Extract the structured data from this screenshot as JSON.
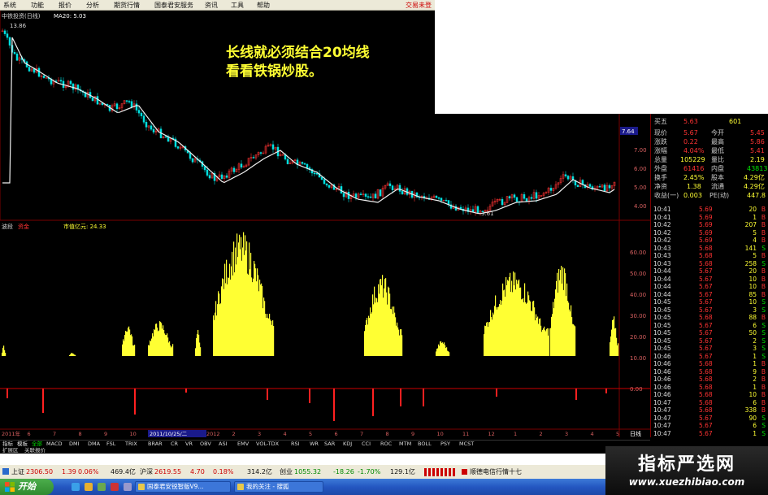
{
  "menu": {
    "items": [
      "系统",
      "功能",
      "报价",
      "分析",
      "期货行情",
      "国泰君安服务",
      "资讯",
      "工具",
      "帮助"
    ],
    "right_label": "交易未登"
  },
  "main_chart": {
    "stock_label": "中铁投资(日线)",
    "ma_label": "MA20: 5.03",
    "high_label": "13.86",
    "low_label": "3.61",
    "annotation_line1": "长线就必须结合20均线",
    "annotation_line2": "看看铁锅炒股。",
    "price_axis": [
      "7.64",
      "7.00",
      "6.00",
      "5.00",
      "4.00"
    ]
  },
  "sub_chart": {
    "name_label": "波段",
    "param_label": "资金",
    "flow_label": "市值亿元: 24.33",
    "axis": [
      "60.00",
      "50.00",
      "40.00",
      "30.00",
      "20.00",
      "10.00"
    ],
    "lower_axis": "0.00"
  },
  "date_axis": {
    "labels": [
      "2011年",
      "6",
      "7",
      "8",
      "9",
      "10",
      "11",
      "12",
      "2012",
      "2",
      "3",
      "4",
      "5",
      "6",
      "7",
      "8",
      "9",
      "10",
      "11",
      "12",
      "1",
      "2",
      "3",
      "4",
      "5"
    ],
    "cursor_date": "2011/10/25/二",
    "corner_label": "日线"
  },
  "quote_panel": {
    "rows": [
      {
        "label": "买五",
        "value": "5.63",
        "right": "601"
      },
      {
        "label": "现价",
        "value": "5.67",
        "label2": "今开",
        "value2": "5.45"
      },
      {
        "label": "涨跌",
        "value": "0.22",
        "label2": "最高",
        "value2": "5.86"
      },
      {
        "label": "涨幅",
        "value": "4.04%",
        "label2": "最低",
        "value2": "5.41"
      },
      {
        "label": "总量",
        "value": "105229",
        "label2": "量比",
        "value2": "2.19"
      },
      {
        "label": "外盘",
        "value": "61416",
        "label2": "内盘",
        "value2": "43813"
      },
      {
        "label": "换手",
        "value": "2.45%",
        "label2": "股本",
        "value2": "4.29亿"
      },
      {
        "label": "净资",
        "value": "1.38",
        "label2": "流通",
        "value2": "4.29亿"
      },
      {
        "label": "收益(一)",
        "value": "0.003",
        "label2": "PE(动)",
        "value2": "447.8"
      }
    ]
  },
  "trades": [
    {
      "t": "10:41",
      "p": "5.69",
      "v": "20",
      "d": "B"
    },
    {
      "t": "10:41",
      "p": "5.69",
      "v": "1",
      "d": "B"
    },
    {
      "t": "10:42",
      "p": "5.69",
      "v": "207",
      "d": "B"
    },
    {
      "t": "10:42",
      "p": "5.69",
      "v": "5",
      "d": "B"
    },
    {
      "t": "10:42",
      "p": "5.69",
      "v": "4",
      "d": "B"
    },
    {
      "t": "10:43",
      "p": "5.68",
      "v": "141",
      "d": "S"
    },
    {
      "t": "10:43",
      "p": "5.68",
      "v": "5",
      "d": "B"
    },
    {
      "t": "10:43",
      "p": "5.68",
      "v": "258",
      "d": "S"
    },
    {
      "t": "10:44",
      "p": "5.67",
      "v": "20",
      "d": "B"
    },
    {
      "t": "10:44",
      "p": "5.67",
      "v": "10",
      "d": "B"
    },
    {
      "t": "10:44",
      "p": "5.67",
      "v": "10",
      "d": "B"
    },
    {
      "t": "10:44",
      "p": "5.67",
      "v": "85",
      "d": "B"
    },
    {
      "t": "10:45",
      "p": "5.67",
      "v": "10",
      "d": "S"
    },
    {
      "t": "10:45",
      "p": "5.67",
      "v": "3",
      "d": "S"
    },
    {
      "t": "10:45",
      "p": "5.68",
      "v": "88",
      "d": "B"
    },
    {
      "t": "10:45",
      "p": "5.67",
      "v": "6",
      "d": "S"
    },
    {
      "t": "10:45",
      "p": "5.67",
      "v": "50",
      "d": "S"
    },
    {
      "t": "10:45",
      "p": "5.67",
      "v": "2",
      "d": "S"
    },
    {
      "t": "10:45",
      "p": "5.67",
      "v": "3",
      "d": "S"
    },
    {
      "t": "10:46",
      "p": "5.67",
      "v": "1",
      "d": "S"
    },
    {
      "t": "10:46",
      "p": "5.68",
      "v": "1",
      "d": "B"
    },
    {
      "t": "10:46",
      "p": "5.68",
      "v": "9",
      "d": "B"
    },
    {
      "t": "10:46",
      "p": "5.68",
      "v": "2",
      "d": "B"
    },
    {
      "t": "10:46",
      "p": "5.68",
      "v": "1",
      "d": "B"
    },
    {
      "t": "10:46",
      "p": "5.68",
      "v": "10",
      "d": "B"
    },
    {
      "t": "10:47",
      "p": "5.68",
      "v": "6",
      "d": "B"
    },
    {
      "t": "10:47",
      "p": "5.68",
      "v": "338",
      "d": "B"
    },
    {
      "t": "10:47",
      "p": "5.67",
      "v": "90",
      "d": "S"
    },
    {
      "t": "10:47",
      "p": "5.67",
      "v": "6",
      "d": "S"
    },
    {
      "t": "10:47",
      "p": "5.67",
      "v": "1",
      "d": "S"
    }
  ],
  "indicator_tabs": [
    "指标",
    "模板",
    "全部",
    "MACD",
    "DMI",
    "DMA",
    "FSL",
    "TRIX",
    "BRAR",
    "CR",
    "VR",
    "OBV",
    "ASI",
    "EMV",
    "VOL-TDX",
    "RSI",
    "WR",
    "SAR",
    "KDJ",
    "CCI",
    "ROC",
    "MTM",
    "BOLL",
    "PSY",
    "MCST"
  ],
  "sub_tabs": [
    "扩展区",
    "关联报价"
  ],
  "status_bar": {
    "sh_label": "上证",
    "sh_value": "2306.50",
    "sh_change": "1.39",
    "sh_pct": "0.06%",
    "sh_amount": "469.4亿",
    "hs_label": "沪深",
    "hs_value": "2619.55",
    "hs_change": "4.70",
    "hs_pct": "0.18%",
    "hs_amount": "314.2亿",
    "cy_label": "创业",
    "cy_value": "1055.32",
    "cy_change": "-18.26",
    "cy_pct": "-1.70%",
    "cy_amount": "129.1亿",
    "news": "顺德电信行情十七"
  },
  "taskbar": {
    "start_label": "开始",
    "tasks": [
      "国泰君安锐智版V9...",
      "我的关注 - 搜狐"
    ]
  },
  "watermark": {
    "title": "指标严选网",
    "url": "www.xuezhibiao.com"
  },
  "colors": {
    "up": "#ff3333",
    "down": "#00e0e0",
    "volume_bar": "#ffff33",
    "flow_bar": "#ff2020",
    "ma": "#f0f0f0",
    "grid": "#7a0000"
  }
}
